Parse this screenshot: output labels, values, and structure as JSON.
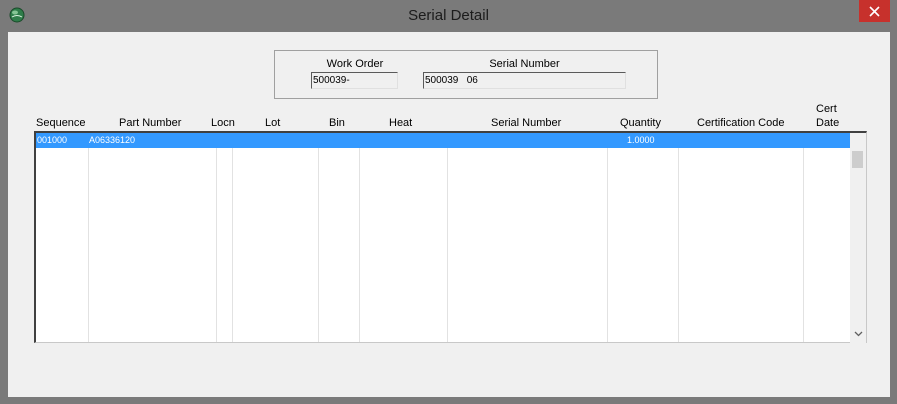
{
  "window": {
    "title": "Serial Detail",
    "close_glyph": "✕"
  },
  "header": {
    "work_order_label": "Work Order",
    "work_order_value": "500039-",
    "serial_number_label": "Serial Number",
    "serial_number_value": "500039   06"
  },
  "grid": {
    "columns": {
      "sequence": "Sequence",
      "part_number": "Part Number",
      "locn": "Locn",
      "lot": "Lot",
      "bin": "Bin",
      "heat": "Heat",
      "serial_number": "Serial Number",
      "quantity": "Quantity",
      "certification_code": "Certification Code",
      "cert_date_line1": "Cert",
      "cert_date_line2": "Date"
    },
    "rows": [
      {
        "sequence": "001000",
        "part_number": "A06336120",
        "quantity": "1.0000"
      }
    ]
  },
  "colors": {
    "selection": "#3399ff",
    "close": "#c7312c",
    "window_frame": "#7a7a7a"
  },
  "icons": {
    "app": "globe-icon",
    "close": "close-icon",
    "scroll_down": "chevron-down-icon"
  }
}
